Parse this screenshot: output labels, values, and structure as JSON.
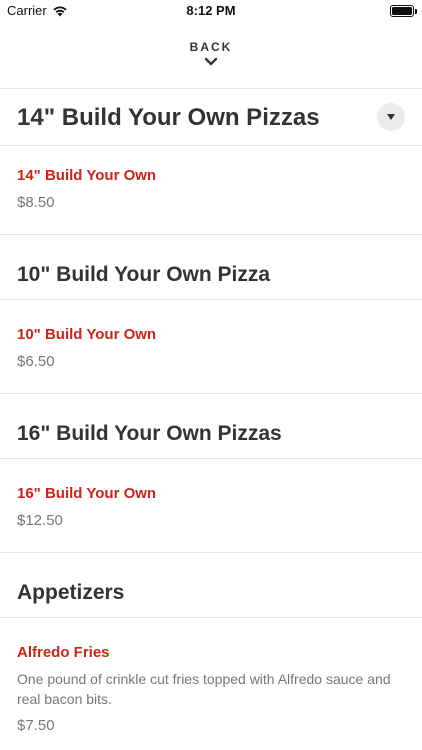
{
  "status_bar": {
    "carrier": "Carrier",
    "time": "8:12 PM",
    "battery_level": 1.0
  },
  "nav": {
    "back_label": "BACK"
  },
  "sections": [
    {
      "title": "14\" Build Your Own Pizzas",
      "items": [
        {
          "name": "14\" Build Your Own",
          "price": "$8.50"
        }
      ]
    },
    {
      "title": "10\" Build Your Own Pizza",
      "items": [
        {
          "name": "10\" Build Your Own",
          "price": "$6.50"
        }
      ]
    },
    {
      "title": "16\" Build Your Own Pizzas",
      "items": [
        {
          "name": "16\" Build Your Own",
          "price": "$12.50"
        }
      ]
    },
    {
      "title": "Appetizers",
      "items": [
        {
          "name": "Alfredo Fries",
          "description": "One pound of crinkle cut fries topped with Alfredo sauce and real bacon bits.",
          "price": "$7.50"
        }
      ]
    }
  ],
  "colors": {
    "item_name": "#cc2418",
    "text": "#333333",
    "muted": "#777777",
    "divider": "#e6e6e6"
  }
}
